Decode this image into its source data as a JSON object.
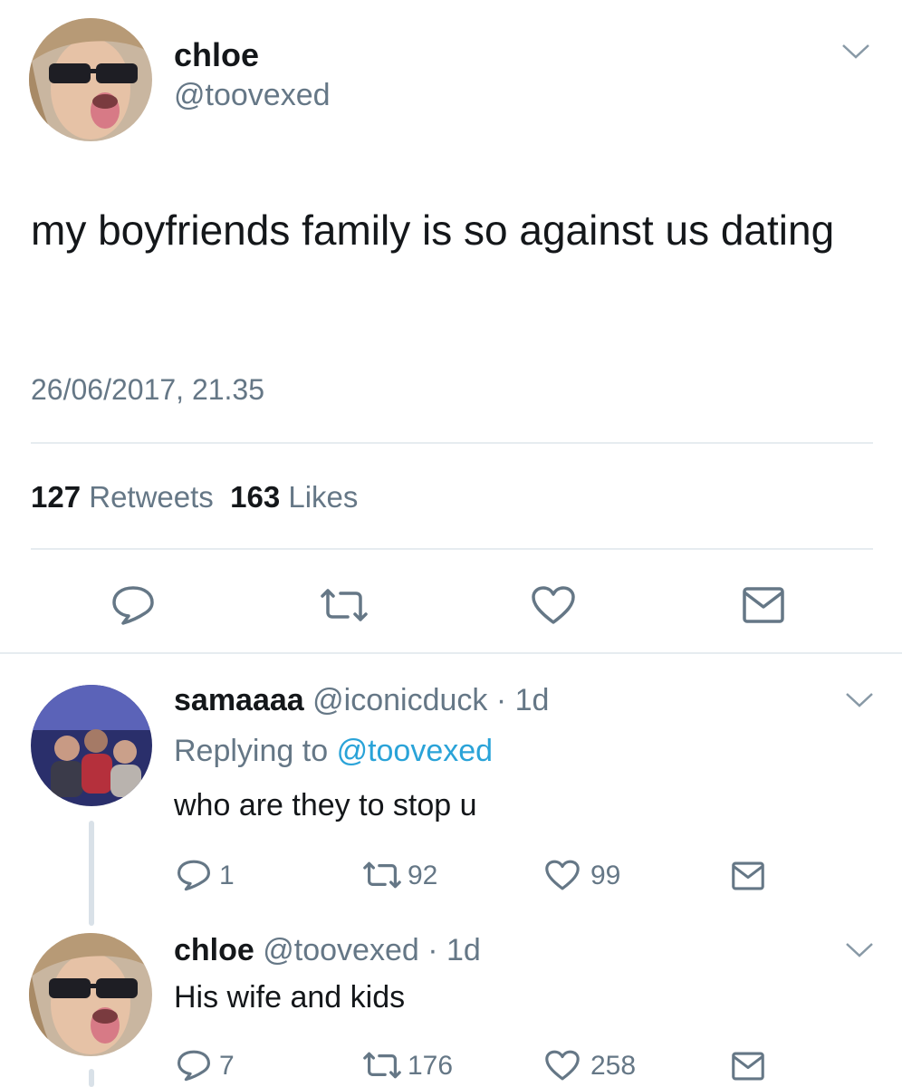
{
  "main_tweet": {
    "name": "chloe",
    "handle": "@toovexed",
    "text": "my boyfriends family is so against us dating",
    "timestamp": "26/06/2017, 21.35",
    "retweets_count": "127",
    "retweets_label": "Retweets",
    "likes_count": "163",
    "likes_label": "Likes"
  },
  "replies": [
    {
      "name": "samaaaa",
      "handle": "@iconicduck",
      "age": "· 1d",
      "replying_label": "Replying to",
      "replying_to": "@toovexed",
      "text": "who are they to stop u",
      "reply_count": "1",
      "retweet_count": "92",
      "like_count": "99"
    },
    {
      "name": "chloe",
      "handle": "@toovexed",
      "age": "· 1d",
      "text": "His wife and kids",
      "reply_count": "7",
      "retweet_count": "176",
      "like_count": "258"
    }
  ],
  "icons": [
    "reply-icon",
    "retweet-icon",
    "like-icon",
    "share-icon",
    "chevron-down-icon"
  ],
  "colors": {
    "text": "#14171a",
    "secondary": "#657786",
    "link": "#2aa3d8",
    "divider": "#e6ecf0"
  }
}
